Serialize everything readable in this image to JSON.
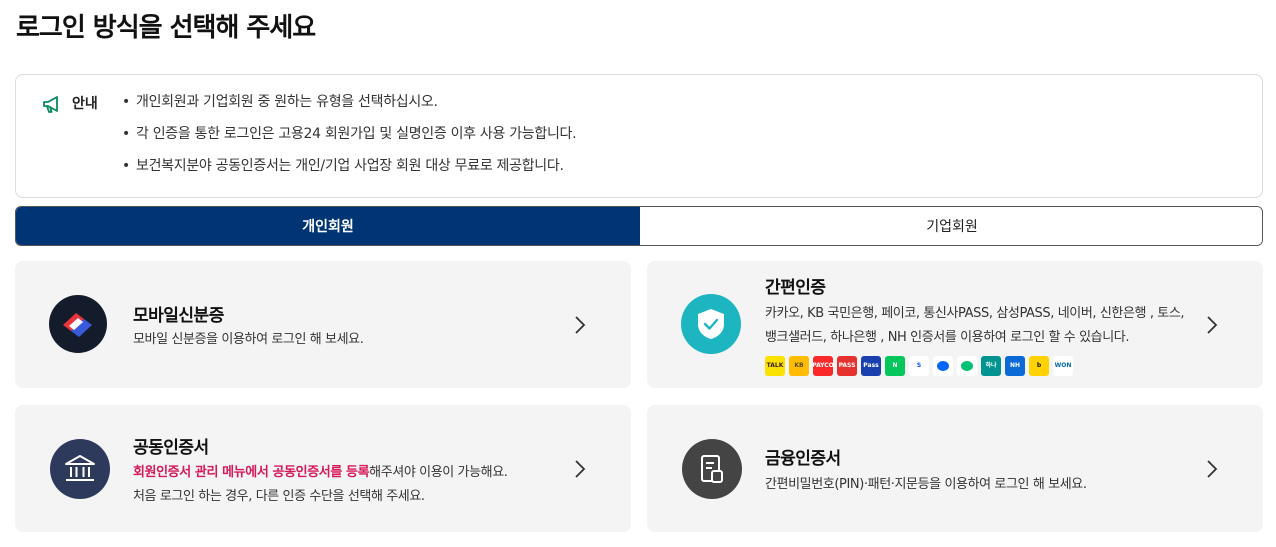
{
  "page": {
    "title": "로그인 방식을 선택해 주세요"
  },
  "notice": {
    "label": "안내",
    "items": [
      "개인회원과 기업회원 중 원하는 유형을 선택하십시오.",
      "각 인증을 통한 로그인은 고용24 회원가입 및 실명인증 이후 사용 가능합니다.",
      "보건복지분야 공동인증서는 개인/기업 사업장 회원 대상 무료로 제공합니다."
    ]
  },
  "tabs": [
    {
      "label": "개인회원",
      "active": true
    },
    {
      "label": "기업회원",
      "active": false
    }
  ],
  "cards": {
    "mobile_id": {
      "title": "모바일신분증",
      "desc": "모바일 신분증을 이용하여 로그인 해 보세요."
    },
    "simple_auth": {
      "title": "간편인증",
      "desc_line1": "카카오, KB 국민은행, 페이코, 통신사PASS, 삼성PASS, 네이버, 신한은행 , 토스,",
      "desc_line2": "뱅크샐러드, 하나은행 , NH 인증서를 이용하여 로그인 할 수 있습니다.",
      "providers": [
        {
          "name": "kakao",
          "text": "TALK",
          "bg": "#fae100",
          "fg": "#3c1e1e"
        },
        {
          "name": "kb",
          "text": "KB",
          "bg": "#ffbc00",
          "fg": "#5b4a1e"
        },
        {
          "name": "payco",
          "text": "PAYCO",
          "bg": "#fa2828",
          "fg": "#ffffff"
        },
        {
          "name": "pass",
          "text": "PASS",
          "bg": "#e6312e",
          "fg": "#ffffff"
        },
        {
          "name": "samsung-pass",
          "text": "Pass",
          "bg": "#1a3faf",
          "fg": "#ffffff"
        },
        {
          "name": "naver",
          "text": "N",
          "bg": "#03c75a",
          "fg": "#ffffff"
        },
        {
          "name": "shinhan",
          "text": "S",
          "bg": "#ffffff",
          "fg": "#0046ff"
        },
        {
          "name": "toss",
          "text": "",
          "bg": "#ffffff",
          "fg": "#0064ff"
        },
        {
          "name": "banksalad",
          "text": "",
          "bg": "#ffffff",
          "fg": "#00c073"
        },
        {
          "name": "hana",
          "text": "하나",
          "bg": "#009490",
          "fg": "#ffffff"
        },
        {
          "name": "nh",
          "text": "NH",
          "bg": "#0b6ad6",
          "fg": "#ffffff"
        },
        {
          "name": "kbank",
          "text": "b",
          "bg": "#ffd200",
          "fg": "#111111"
        },
        {
          "name": "woori",
          "text": "WON",
          "bg": "#ffffff",
          "fg": "#0067ac"
        }
      ]
    },
    "joint_cert": {
      "title": "공동인증서",
      "desc_highlight": "회원인증서 관리 메뉴에서 공동인증서를 등록",
      "desc_rest": "해주셔야 이용이 가능해요.",
      "desc_line2": "처음 로그인 하는 경우, 다른 인증 수단을 선택해 주세요."
    },
    "financial_cert": {
      "title": "금융인증서",
      "desc": "간편비밀번호(PIN)·패턴·지문등을 이용하여 로그인 해 보세요."
    }
  },
  "colors": {
    "primary": "#003575",
    "highlight": "#d6195a",
    "card_bg": "#f4f4f4",
    "simple_icon": "#1db5c0",
    "joint_icon": "#2e3a5c",
    "fin_icon": "#444444"
  },
  "icons": {
    "notice": "megaphone-icon",
    "mobile_id": "mobile-id-logo-icon",
    "simple_auth": "shield-check-icon",
    "joint_cert": "bank-building-icon",
    "financial_cert": "document-icon",
    "card_arrow": "chevron-right-icon"
  }
}
